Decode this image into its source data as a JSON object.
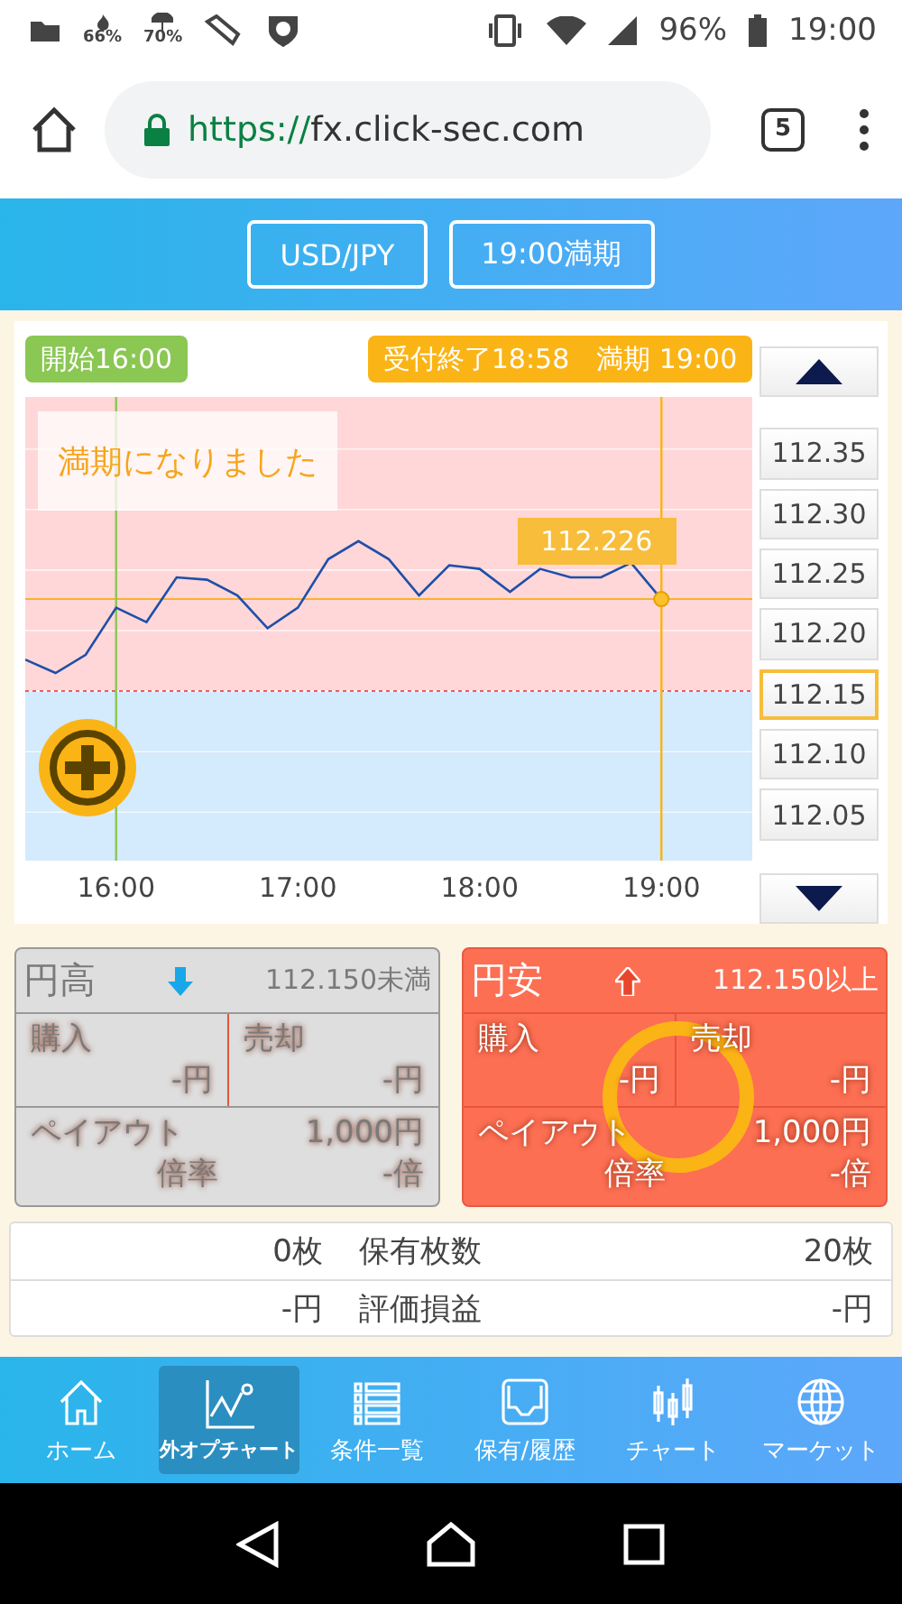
{
  "status_bar": {
    "indicators": [
      "66%",
      "70%"
    ],
    "battery": "96%",
    "time": "19:00"
  },
  "browser": {
    "url_scheme": "https://",
    "url_host": "fx.click-sec.com",
    "tab_count": "5"
  },
  "header": {
    "buttons": [
      "USD/JPY",
      "19:00満期"
    ]
  },
  "chart": {
    "message": "満期になりました",
    "chart_data": {
      "type": "line",
      "xlim": [
        15.5,
        19.5
      ],
      "ylim": [
        112.01,
        112.393
      ],
      "xticks": [
        {
          "value": 16,
          "label": "16:00"
        },
        {
          "value": 17,
          "label": "17:00"
        },
        {
          "value": 18,
          "label": "18:00"
        },
        {
          "value": 19,
          "label": "19:00"
        }
      ],
      "yticks": [
        {
          "value": 112.35,
          "label": "112.35"
        },
        {
          "value": 112.3,
          "label": "112.30"
        },
        {
          "value": 112.25,
          "label": "112.25"
        },
        {
          "value": 112.2,
          "label": "112.20"
        },
        {
          "value": 112.15,
          "label": "112.15"
        },
        {
          "value": 112.1,
          "label": "112.10"
        },
        {
          "value": 112.05,
          "label": "112.05"
        }
      ],
      "x": [
        15.5,
        15.667,
        15.833,
        16,
        16.167,
        16.333,
        16.5,
        16.667,
        16.833,
        17,
        17.167,
        17.333,
        17.5,
        17.667,
        17.833,
        18,
        18.167,
        18.333,
        18.5,
        18.667,
        18.833,
        19
      ],
      "series": [
        {
          "color": "#1f4fa8",
          "values": [
            112.176,
            112.165,
            112.18,
            112.219,
            112.207,
            112.244,
            112.242,
            112.229,
            112.202,
            112.219,
            112.259,
            112.274,
            112.259,
            112.229,
            112.254,
            112.251,
            112.232,
            112.251,
            112.244,
            112.244,
            112.256,
            112.226
          ]
        }
      ],
      "bands": [
        {
          "axis": "y",
          "from": 112.15,
          "to": 112.393,
          "color": "#ffd7d8"
        },
        {
          "axis": "y",
          "from": 112.01,
          "to": 112.15,
          "color": "#d4eafd"
        }
      ],
      "grid": true,
      "ref_lines": [
        {
          "axis": "y",
          "value": 112.15,
          "color": "#f05a5a"
        },
        {
          "axis": "y",
          "value": 112.226,
          "color": "#f7b230",
          "label": "112.226"
        },
        {
          "axis": "x",
          "value": 16,
          "color": "#8bc753",
          "label": "開始16:00"
        },
        {
          "axis": "x",
          "value": 19,
          "color": "#fbb415",
          "label": "受付終了18:58　満期 19:00"
        }
      ]
    },
    "price_levels": [
      {
        "selected": false
      },
      {
        "selected": false
      },
      {
        "selected": false
      },
      {
        "selected": false
      },
      {
        "selected": true
      },
      {
        "selected": false
      },
      {
        "selected": false
      }
    ]
  },
  "options": [
    {
      "title": "円高",
      "kind": "down",
      "threshold": "112.150未満",
      "selected": false,
      "buy_label": "購入",
      "buy_value": "-円",
      "sell_label": "売却",
      "sell_value": "-円",
      "payout_label": "ペイアウト",
      "payout": "1,000円",
      "rate_label": "倍率",
      "rate": "-倍"
    },
    {
      "title": "円安",
      "kind": "up",
      "threshold": "112.150以上",
      "selected": true,
      "buy_label": "購入",
      "buy_value": "-円",
      "sell_label": "売却",
      "sell_value": "-円",
      "payout_label": "ペイアウト",
      "payout": "1,000円",
      "rate_label": "倍率",
      "rate": "-倍"
    }
  ],
  "holdings": [
    {
      "left": "0枚",
      "label": "保有枚数",
      "right": "20枚"
    },
    {
      "left": "-円",
      "label": "評価損益",
      "right": "-円"
    }
  ],
  "nav": [
    {
      "label": "ホーム",
      "kind": "home",
      "selected": false
    },
    {
      "label": "外オプチャート",
      "kind": "chart",
      "selected": true
    },
    {
      "label": "条件一覧",
      "kind": "list",
      "selected": false
    },
    {
      "label": "保有/履歴",
      "kind": "tray",
      "selected": false
    },
    {
      "label": "チャート",
      "kind": "candles",
      "selected": false
    },
    {
      "label": "マーケット",
      "kind": "globe",
      "selected": false
    }
  ]
}
